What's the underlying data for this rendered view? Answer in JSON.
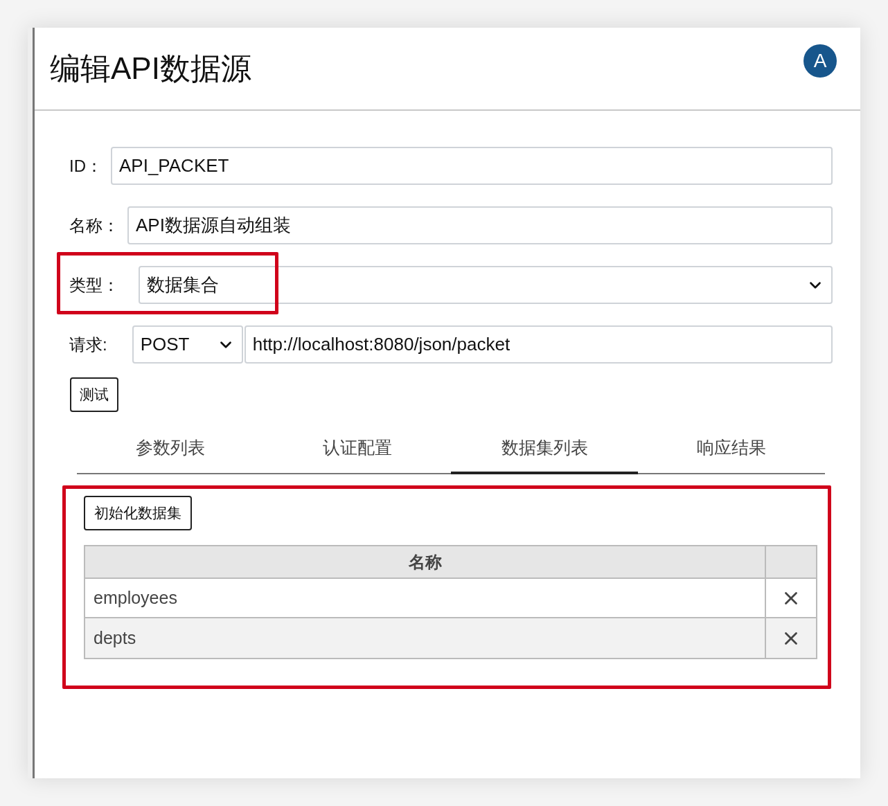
{
  "dialog": {
    "title": "编辑API数据源",
    "avatar": "A"
  },
  "fields": [
    {
      "kind": "text",
      "label": "ID：",
      "value": "API_PACKET",
      "highlighted": false
    },
    {
      "kind": "text",
      "label": "名称：",
      "value": "API数据源自动组装",
      "highlighted": false
    },
    {
      "kind": "select",
      "label": "类型：",
      "value": "数据集合",
      "highlighted": true
    },
    {
      "kind": "request",
      "label": "请求:",
      "method": "POST",
      "value": "http://localhost:8080/json/packet",
      "highlighted": false
    }
  ],
  "test_button": "测试",
  "tabs": [
    {
      "label": "参数列表",
      "selected": false
    },
    {
      "label": "认证配置",
      "selected": false
    },
    {
      "label": "数据集列表",
      "selected": true
    },
    {
      "label": "响应结果",
      "selected": false
    }
  ],
  "panel": {
    "highlighted": true,
    "init_button": "初始化数据集",
    "columns": [
      "名称"
    ],
    "rows": [
      {
        "name": "employees"
      },
      {
        "name": "depts"
      }
    ]
  }
}
